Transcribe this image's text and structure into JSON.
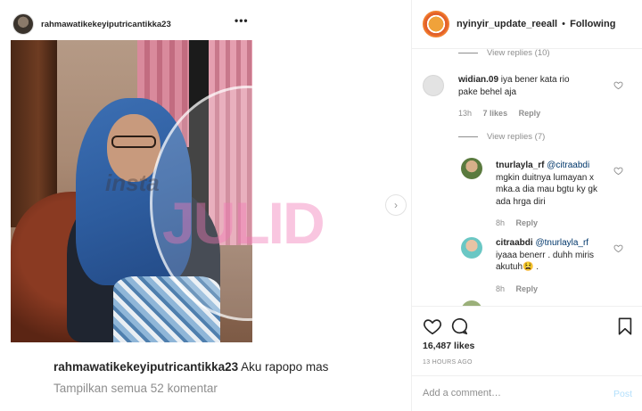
{
  "left_post": {
    "username": "rahmawatikekeyiputricantikka23",
    "more": "•••",
    "caption_user": "rahmawatikekeyiputricantikka23",
    "caption_text": "Aku rapopo mas",
    "view_all_comments": "Tampilkan semua 52 komentar",
    "watermark_insta": "insta",
    "watermark_julid": "JULID",
    "next_arrow": "›"
  },
  "right_panel": {
    "username": "nyinyir_update_reeall",
    "separator": "•",
    "follow_status": "Following",
    "comments": {
      "view_replies_1": "View replies (10)",
      "c1_user": "widian.09",
      "c1_text": "iya bener kata rio pake behel aja",
      "c1_time": "13h",
      "c1_likes": "7 likes",
      "c1_reply": "Reply",
      "view_replies_2": "View replies (7)",
      "r1_user": "tnurlayla_rf",
      "r1_mention": "@citraabdi",
      "r1_text": "mgkin duitnya lumayan x mka.a dia mau bgtu ky gk ada hrga diri",
      "r1_time": "8h",
      "r1_reply": "Reply",
      "r2_user": "citraabdi",
      "r2_mention": "@tnurlayla_rf",
      "r2_text": "iyaaa benerr . duhh miris akutuh😫 .",
      "r2_time": "8h",
      "r2_reply": "Reply"
    },
    "likes": "16,487 likes",
    "time_ago": "13 HOURS AGO",
    "add_comment_placeholder": "Add a comment…",
    "post_button": "Post"
  },
  "colors": {
    "accent_link": "#00376b",
    "post_disabled": "#b2dffc",
    "muted": "#8e8e8e"
  }
}
